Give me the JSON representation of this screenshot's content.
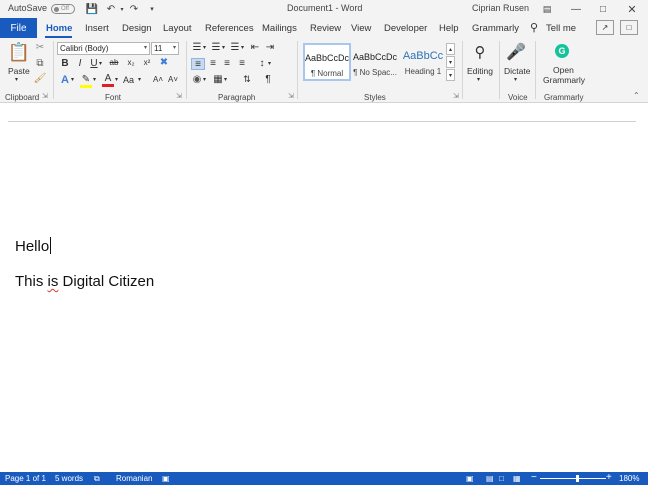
{
  "titlebar": {
    "autosave_label": "AutoSave",
    "autosave_state": "Off",
    "document_title": "Document1 - Word",
    "user_name": "Ciprian Rusen"
  },
  "ribbon_tabs": {
    "file": "File",
    "items": [
      "Home",
      "Insert",
      "Design",
      "Layout",
      "References",
      "Mailings",
      "Review",
      "View",
      "Developer",
      "Help",
      "Grammarly"
    ],
    "active": "Home",
    "tell_me": "Tell me"
  },
  "clipboard": {
    "paste_label": "Paste",
    "group_label": "Clipboard"
  },
  "font": {
    "font_name": "Calibri (Body)",
    "font_size": "11",
    "group_label": "Font",
    "bold": "B",
    "italic": "I",
    "underline": "U",
    "strike": "ab",
    "subscript": "x₂",
    "superscript": "x²",
    "change_case": "Aa",
    "grow": "A˄",
    "shrink": "A˅"
  },
  "paragraph": {
    "group_label": "Paragraph",
    "pilcrow": "¶"
  },
  "styles": {
    "group_label": "Styles",
    "items": [
      {
        "preview": "AaBbCcDc",
        "name": "¶ Normal",
        "preview_color": "#222222"
      },
      {
        "preview": "AaBbCcDc",
        "name": "¶ No Spac...",
        "preview_color": "#222222"
      },
      {
        "preview": "AaBbCc",
        "name": "Heading 1",
        "preview_color": "#2e74b5"
      }
    ]
  },
  "editing": {
    "label": "Editing"
  },
  "voice": {
    "dictate_label": "Dictate",
    "group_label": "Voice"
  },
  "grammarly": {
    "open_label_1": "Open",
    "open_label_2": "Grammarly",
    "group_label": "Grammarly"
  },
  "document": {
    "line1": "Hello",
    "line2_part1": "This ",
    "line2_misspelled": "is",
    "line2_part2": " Digital Citizen"
  },
  "statusbar": {
    "page": "Page 1 of 1",
    "words": "5 words",
    "language": "Romanian",
    "zoom": "180%",
    "minus": "−",
    "plus": "+"
  },
  "colors": {
    "accent": "#185abd",
    "highlight": "#ffff00",
    "font_color": "#e02020",
    "grammarly": "#15c39a"
  }
}
